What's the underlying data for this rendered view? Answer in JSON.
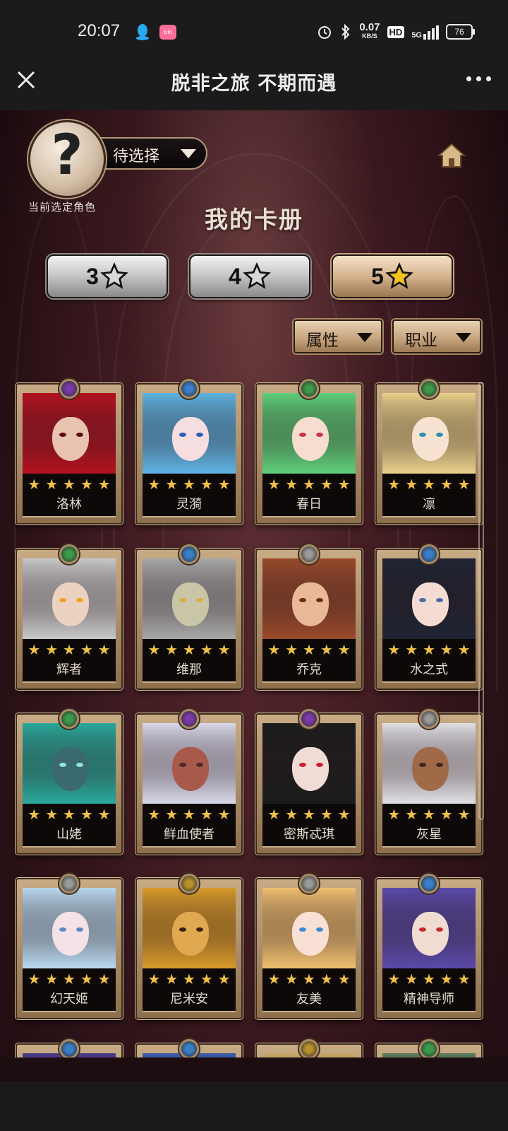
{
  "status_bar": {
    "time": "20:07",
    "speed_value": "0.07",
    "speed_unit": "KB/S",
    "hd_label": "HD",
    "network": "5G",
    "battery": "76",
    "icons": [
      "qq-icon",
      "bilibili-icon",
      "alarm-icon",
      "bluetooth-icon"
    ]
  },
  "nav": {
    "title": "脱非之旅 不期而遇",
    "close_icon": "close-icon",
    "more_icon": "more-icon"
  },
  "game": {
    "avatar_symbol": "?",
    "select_label": "待选择",
    "avatar_caption": "当前选定角色",
    "page_title": "我的卡册",
    "star_tabs": [
      {
        "label": "3",
        "active": false
      },
      {
        "label": "4",
        "active": false
      },
      {
        "label": "5",
        "active": true
      }
    ],
    "filters": [
      {
        "label": "属性"
      },
      {
        "label": "职业"
      }
    ],
    "cards": [
      {
        "name": "洛林",
        "stars": 5,
        "hair": "#b3121f",
        "skin": "#e8c3b0",
        "badge": "#7a3aa8",
        "eye": "#5b0d12"
      },
      {
        "name": "灵漪",
        "stars": 5,
        "hair": "#5fb3e2",
        "skin": "#f6dde0",
        "badge": "#3a7fc8",
        "eye": "#2a5fb8"
      },
      {
        "name": "春日",
        "stars": 5,
        "hair": "#5fcf7a",
        "skin": "#f6ddd0",
        "badge": "#3d9a4a",
        "eye": "#c8334a"
      },
      {
        "name": "凛",
        "stars": 5,
        "hair": "#e8d08a",
        "skin": "#f8e2d2",
        "badge": "#3d9a4a",
        "eye": "#2d8fb5"
      },
      {
        "name": "辉者",
        "stars": 5,
        "hair": "#c8c8c8",
        "skin": "#ecd2c0",
        "badge": "#3d9a4a",
        "eye": "#f0a11f"
      },
      {
        "name": "维那",
        "stars": 5,
        "hair": "#a8a8a8",
        "skin": "#c9c6a8",
        "badge": "#3a7fc8",
        "eye": "#d8b040"
      },
      {
        "name": "乔克",
        "stars": 5,
        "hair": "#9a4a2a",
        "skin": "#e8b898",
        "badge": "#9a9a9a",
        "eye": "#6a2a1a"
      },
      {
        "name": "水之式",
        "stars": 5,
        "hair": "#1f2433",
        "skin": "#f4dcd2",
        "badge": "#3a7fc8",
        "eye": "#4a6aa8"
      },
      {
        "name": "山姥",
        "stars": 5,
        "hair": "#2aa89a",
        "skin": "#3a6a70",
        "badge": "#3d9a4a",
        "eye": "#8fe8e0"
      },
      {
        "name": "鲜血使者",
        "stars": 5,
        "hair": "#d8d8e8",
        "skin": "#a85a4a",
        "badge": "#7a3aa8",
        "eye": "#4a2a2a"
      },
      {
        "name": "密斯忒琪",
        "stars": 5,
        "hair": "#1c1c1c",
        "skin": "#f0dcd4",
        "badge": "#7a3aa8",
        "eye": "#c82030"
      },
      {
        "name": "灰星",
        "stars": 5,
        "hair": "#e0e0e4",
        "skin": "#a06a48",
        "badge": "#9a9a9a",
        "eye": "#3a2a22"
      },
      {
        "name": "幻天姬",
        "stars": 5,
        "hair": "#b8d8ee",
        "skin": "#f4e2e6",
        "badge": "#9a9a9a",
        "eye": "#5a8ac8"
      },
      {
        "name": "尼米安",
        "stars": 5,
        "hair": "#d89a2a",
        "skin": "#e0a850",
        "badge": "#b8902a",
        "eye": "#3a2010"
      },
      {
        "name": "友美",
        "stars": 5,
        "hair": "#f0c070",
        "skin": "#f8e0d4",
        "badge": "#9a9a9a",
        "eye": "#3a8ad8"
      },
      {
        "name": "精神导师",
        "stars": 5,
        "hair": "#5a4aa8",
        "skin": "#f0dcd0",
        "badge": "#3a7fc8",
        "eye": "#c82828"
      },
      {
        "name": "",
        "stars": 0,
        "hair": "#4a3a8a",
        "skin": "#e8d0c8",
        "badge": "#3a7fc8",
        "eye": "#333333"
      },
      {
        "name": "",
        "stars": 0,
        "hair": "#3a5aa8",
        "skin": "#e8d0c8",
        "badge": "#3a7fc8",
        "eye": "#333333"
      },
      {
        "name": "",
        "stars": 0,
        "hair": "#c8a868",
        "skin": "#e8d0c8",
        "badge": "#b8902a",
        "eye": "#333333"
      },
      {
        "name": "",
        "stars": 0,
        "hair": "#5a7a5a",
        "skin": "#e8d0c8",
        "badge": "#3d9a4a",
        "eye": "#333333"
      }
    ]
  },
  "colors": {
    "star_color": "#f0c14a",
    "frame_gold": "#c8ab85",
    "background": "#30141a"
  }
}
